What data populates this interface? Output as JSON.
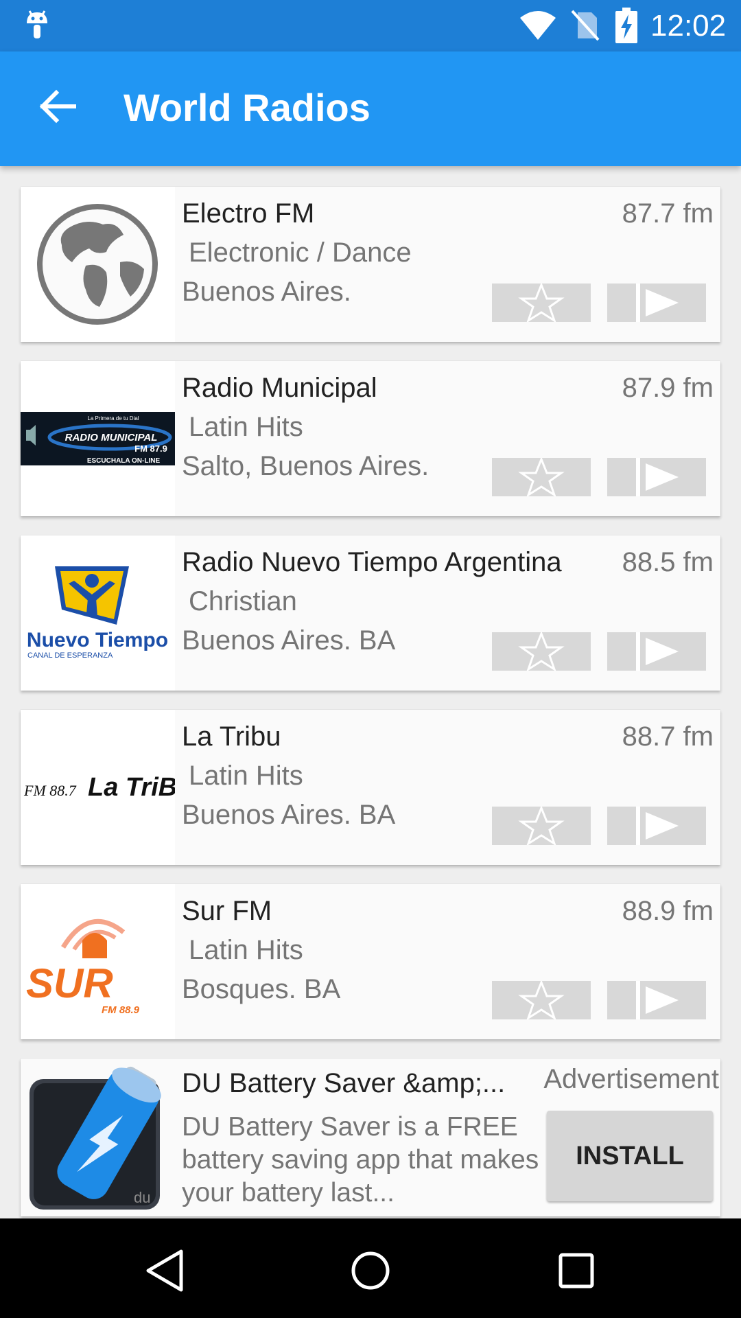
{
  "status_bar": {
    "time": "12:02",
    "icons": [
      "android-notification-icon",
      "wifi-icon",
      "no-sim-icon",
      "battery-charging-icon"
    ]
  },
  "app_bar": {
    "title": "World Radios",
    "back_icon": "arrow-left-icon"
  },
  "stations": [
    {
      "name": "Electro FM",
      "genre": "Electronic / Dance",
      "city": "Buenos Aires.",
      "frequency": "87.7 fm",
      "logo": "globe-icon"
    },
    {
      "name": "Radio Municipal",
      "genre": "Latin Hits",
      "city": "Salto, Buenos Aires.",
      "frequency": "87.9 fm",
      "logo": "radio-municipal-logo",
      "logo_text": [
        "La Primera de tu Dial",
        "RADIO MUNICIPAL",
        "FM 87.9",
        "ESCUCHALA ON-LINE"
      ]
    },
    {
      "name": "Radio Nuevo Tiempo Argentina",
      "genre": "Christian",
      "city": "Buenos Aires. BA",
      "frequency": "88.5 fm",
      "logo": "nuevo-tiempo-logo",
      "logo_text": [
        "Nuevo Tiempo",
        "CANAL DE ESPERANZA"
      ]
    },
    {
      "name": "La Tribu",
      "genre": "Latin Hits",
      "city": "Buenos Aires. BA",
      "frequency": "88.7 fm",
      "logo": "la-tribu-logo",
      "logo_text": [
        "FM 88.7",
        "La TriBu"
      ]
    },
    {
      "name": "Sur FM",
      "genre": "Latin Hits",
      "city": "Bosques. BA",
      "frequency": "88.9 fm",
      "logo": "sur-fm-logo",
      "logo_text": [
        "SUR",
        "FM 88.9"
      ]
    }
  ],
  "ad": {
    "title": "DU Battery Saver &amp;...",
    "label": "Advertisement",
    "description": "DU Battery Saver is a FREE battery saving app that makes your battery last...",
    "install_label": "INSTALL",
    "logo_text": "du"
  },
  "nav_bar": {
    "buttons": [
      "back-triangle-icon",
      "home-circle-icon",
      "recents-square-icon"
    ]
  },
  "colors": {
    "status_bar": "#1e7fd6",
    "app_bar": "#2196f3",
    "background": "#eeeeee",
    "card": "#fafafa",
    "button_gray": "#d8d8d8"
  }
}
